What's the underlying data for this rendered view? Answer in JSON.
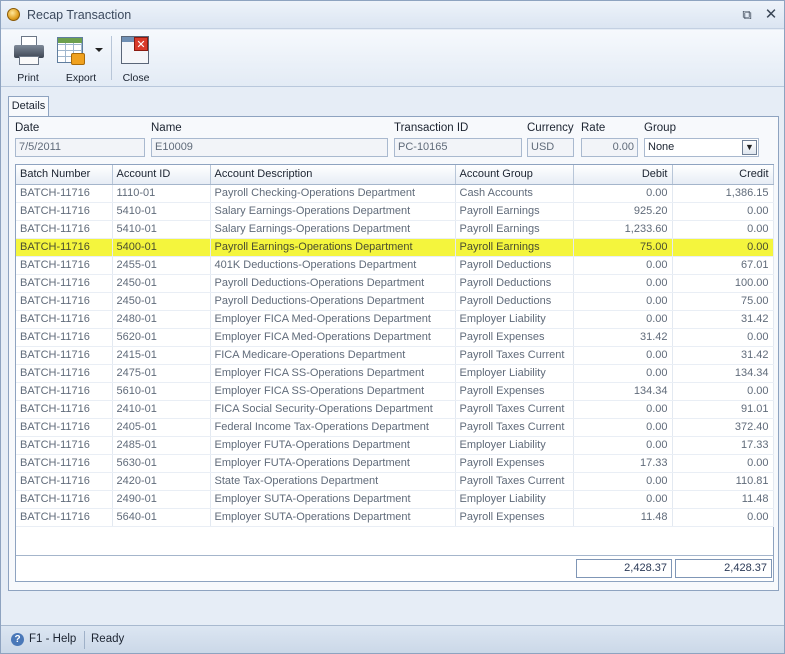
{
  "window": {
    "title": "Recap  Transaction",
    "restore_glyph": "⧉",
    "close_glyph": "✕"
  },
  "toolbar": {
    "print_label": "Print",
    "export_label": "Export",
    "close_label": "Close",
    "icons": {
      "print": "printer-icon",
      "export": "spreadsheet-export-icon",
      "close": "close-window-icon"
    }
  },
  "tabs": [
    {
      "label": "Details"
    }
  ],
  "header": {
    "date_label": "Date",
    "date_value": "7/5/2011",
    "name_label": "Name",
    "name_value": "E10009",
    "transaction_label": "Transaction ID",
    "transaction_value": "PC-10165",
    "currency_label": "Currency",
    "currency_value": "USD",
    "rate_label": "Rate",
    "rate_value": "0.00",
    "group_label": "Group",
    "group_value": "None"
  },
  "grid": {
    "columns": [
      "Batch Number",
      "Account ID",
      "Account Description",
      "Account Group",
      "Debit",
      "Credit"
    ],
    "rows": [
      [
        "BATCH-11716",
        "1110-01",
        "Payroll Checking-Operations Department",
        "Cash Accounts",
        "0.00",
        "1,386.15"
      ],
      [
        "BATCH-11716",
        "5410-01",
        "Salary Earnings-Operations Department",
        "Payroll Earnings",
        "925.20",
        "0.00"
      ],
      [
        "BATCH-11716",
        "5410-01",
        "Salary Earnings-Operations Department",
        "Payroll Earnings",
        "1,233.60",
        "0.00"
      ],
      [
        "BATCH-11716",
        "5400-01",
        "Payroll Earnings-Operations Department",
        "Payroll Earnings",
        "75.00",
        "0.00"
      ],
      [
        "BATCH-11716",
        "2455-01",
        "401K Deductions-Operations Department",
        "Payroll Deductions",
        "0.00",
        "67.01"
      ],
      [
        "BATCH-11716",
        "2450-01",
        "Payroll Deductions-Operations Department",
        "Payroll Deductions",
        "0.00",
        "100.00"
      ],
      [
        "BATCH-11716",
        "2450-01",
        "Payroll Deductions-Operations Department",
        "Payroll Deductions",
        "0.00",
        "75.00"
      ],
      [
        "BATCH-11716",
        "2480-01",
        "Employer FICA Med-Operations Department",
        "Employer Liability",
        "0.00",
        "31.42"
      ],
      [
        "BATCH-11716",
        "5620-01",
        "Employer FICA Med-Operations Department",
        "Payroll Expenses",
        "31.42",
        "0.00"
      ],
      [
        "BATCH-11716",
        "2415-01",
        "FICA Medicare-Operations Department",
        "Payroll Taxes Current",
        "0.00",
        "31.42"
      ],
      [
        "BATCH-11716",
        "2475-01",
        "Employer FICA SS-Operations Department",
        "Employer Liability",
        "0.00",
        "134.34"
      ],
      [
        "BATCH-11716",
        "5610-01",
        "Employer FICA SS-Operations Department",
        "Payroll Expenses",
        "134.34",
        "0.00"
      ],
      [
        "BATCH-11716",
        "2410-01",
        "FICA Social Security-Operations Department",
        "Payroll Taxes Current",
        "0.00",
        "91.01"
      ],
      [
        "BATCH-11716",
        "2405-01",
        "Federal Income Tax-Operations Department",
        "Payroll Taxes Current",
        "0.00",
        "372.40"
      ],
      [
        "BATCH-11716",
        "2485-01",
        "Employer FUTA-Operations Department",
        "Employer Liability",
        "0.00",
        "17.33"
      ],
      [
        "BATCH-11716",
        "5630-01",
        "Employer FUTA-Operations Department",
        "Payroll Expenses",
        "17.33",
        "0.00"
      ],
      [
        "BATCH-11716",
        "2420-01",
        "State Tax-Operations Department",
        "Payroll Taxes Current",
        "0.00",
        "110.81"
      ],
      [
        "BATCH-11716",
        "2490-01",
        "Employer SUTA-Operations Department",
        "Employer Liability",
        "0.00",
        "11.48"
      ],
      [
        "BATCH-11716",
        "5640-01",
        "Employer SUTA-Operations Department",
        "Payroll Expenses",
        "11.48",
        "0.00"
      ]
    ],
    "highlighted_row": 3,
    "highlight_color": "#f4f53d",
    "total_debit": "2,428.37",
    "total_credit": "2,428.37"
  },
  "statusbar": {
    "help_label": "F1 - Help",
    "status_text": "Ready"
  }
}
